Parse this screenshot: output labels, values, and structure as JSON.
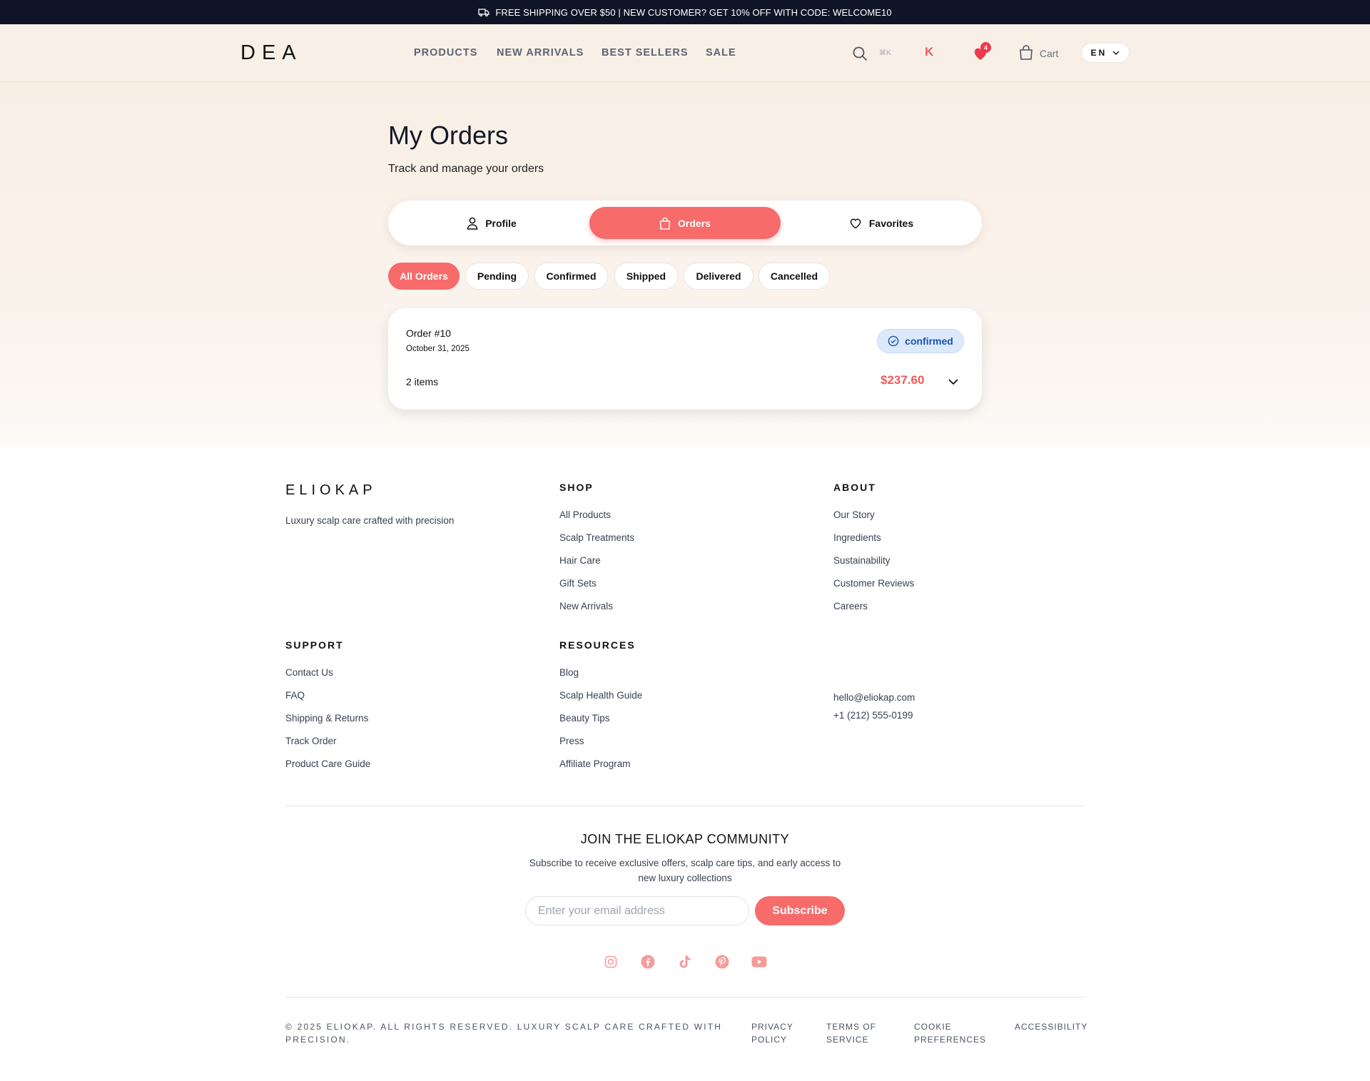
{
  "announcement": {
    "text": "FREE SHIPPING OVER $50 | NEW CUSTOMER? GET 10% OFF WITH CODE: WELCOME10"
  },
  "header": {
    "logo": "DEA",
    "nav": [
      "PRODUCTS",
      "NEW ARRIVALS",
      "BEST SELLERS",
      "SALE"
    ],
    "search_shortcut": "⌘K",
    "avatar_initial": "K",
    "favorites_count": "4",
    "cart_label": "Cart",
    "language": "EN"
  },
  "page": {
    "title": "My Orders",
    "subtitle": "Track and manage your orders"
  },
  "account_tabs": [
    {
      "label": "Profile",
      "icon": "user-icon"
    },
    {
      "label": "Orders",
      "icon": "shopping-bag-icon",
      "active": true
    },
    {
      "label": "Favorites",
      "icon": "heart-icon"
    }
  ],
  "filters": [
    "All Orders",
    "Pending",
    "Confirmed",
    "Shipped",
    "Delivered",
    "Cancelled"
  ],
  "active_filter": "All Orders",
  "orders": [
    {
      "number": "Order #10",
      "date": "October 31, 2025",
      "status": "confirmed",
      "items": "2 items",
      "total": "$237.60"
    }
  ],
  "footer": {
    "brand": "ELIOKAP",
    "tagline": "Luxury scalp care crafted with precision",
    "shop": {
      "heading": "SHOP",
      "links": [
        "All Products",
        "Scalp Treatments",
        "Hair Care",
        "Gift Sets",
        "New Arrivals"
      ]
    },
    "about": {
      "heading": "ABOUT",
      "links": [
        "Our Story",
        "Ingredients",
        "Sustainability",
        "Customer Reviews",
        "Careers"
      ]
    },
    "support": {
      "heading": "SUPPORT",
      "links": [
        "Contact Us",
        "FAQ",
        "Shipping & Returns",
        "Track Order",
        "Product Care Guide"
      ]
    },
    "resources": {
      "heading": "RESOURCES",
      "links": [
        "Blog",
        "Scalp Health Guide",
        "Beauty Tips",
        "Press",
        "Affiliate Program"
      ]
    },
    "contact": {
      "email": "hello@eliokap.com",
      "phone": "+1 (212) 555-0199"
    },
    "newsletter": {
      "title": "JOIN THE ELIOKAP COMMUNITY",
      "subtitle": "Subscribe to receive exclusive offers, scalp care tips, and early access to new luxury collections",
      "placeholder": "Enter your email address",
      "button": "Subscribe"
    },
    "social": [
      "instagram-icon",
      "facebook-icon",
      "tiktok-icon",
      "pinterest-icon",
      "youtube-icon"
    ],
    "copyright": "© 2025 ELIOKAP. ALL RIGHTS RESERVED. LUXURY SCALP CARE CRAFTED WITH PRECISION.",
    "legal_links": [
      "PRIVACY POLICY",
      "TERMS OF SERVICE",
      "COOKIE PREFERENCES",
      "ACCESSIBILITY"
    ]
  },
  "colors": {
    "accent": "#f76b6b",
    "dark": "#0f1526",
    "status_bg": "#dbe9fb",
    "status_text": "#1d4fb8"
  }
}
